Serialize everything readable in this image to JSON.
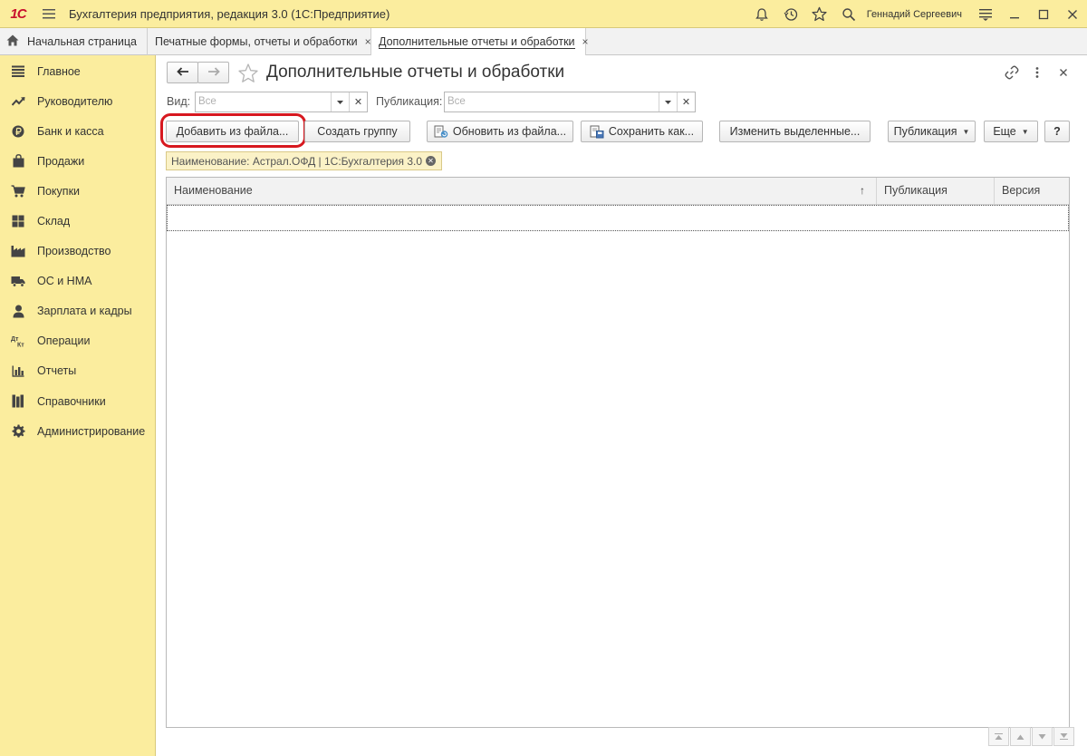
{
  "titlebar": {
    "logo": "1С",
    "title": "Бухгалтерия предприятия, редакция 3.0  (1С:Предприятие)",
    "username": "Геннадий Сергеевич"
  },
  "tabs": {
    "home": "Начальная страница",
    "items": [
      {
        "label": "Печатные формы, отчеты и обработки",
        "close": "×"
      },
      {
        "label": "Дополнительные отчеты и обработки",
        "close": "×"
      }
    ]
  },
  "sidebar": {
    "items": [
      {
        "label": "Главное",
        "icon": "list-icon"
      },
      {
        "label": "Руководителю",
        "icon": "trend-icon"
      },
      {
        "label": "Банк и касса",
        "icon": "ruble-icon"
      },
      {
        "label": "Продажи",
        "icon": "bag-icon"
      },
      {
        "label": "Покупки",
        "icon": "cart-icon"
      },
      {
        "label": "Склад",
        "icon": "warehouse-icon"
      },
      {
        "label": "Производство",
        "icon": "factory-icon"
      },
      {
        "label": "ОС и НМА",
        "icon": "truck-icon"
      },
      {
        "label": "Зарплата и кадры",
        "icon": "person-icon"
      },
      {
        "label": "Операции",
        "icon": "dtkt-icon"
      },
      {
        "label": "Отчеты",
        "icon": "bar-chart-icon"
      },
      {
        "label": "Справочники",
        "icon": "books-icon"
      },
      {
        "label": "Администрирование",
        "icon": "gear-icon"
      }
    ]
  },
  "form": {
    "title": "Дополнительные отчеты и обработки",
    "filters": {
      "kind_label": "Вид:",
      "kind_value": "Все",
      "publication_label": "Публикация:",
      "publication_value": "Все"
    },
    "buttons": {
      "add_from_file": "Добавить из файла...",
      "create_group": "Создать группу",
      "update_from_file": "Обновить из файла...",
      "save_as": "Сохранить как...",
      "change_selected": "Изменить выделенные...",
      "publication": "Публикация",
      "more": "Еще",
      "help": "?"
    },
    "filter_chip": "Наименование: Астрал.ОФД |  1С:Бухгалтерия 3.0",
    "table": {
      "columns": [
        "Наименование",
        "Публикация",
        "Версия"
      ],
      "sort_indicator": "↑",
      "rows": []
    }
  },
  "colors": {
    "panel_yellow": "#fbed9e",
    "highlight_red": "#d7181f",
    "logo_red": "#c8102e"
  }
}
